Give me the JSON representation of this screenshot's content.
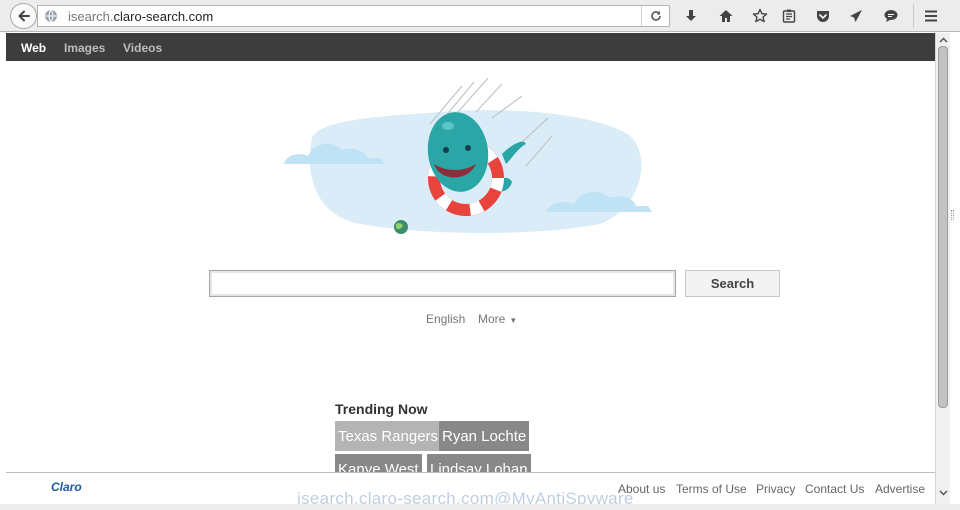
{
  "browser": {
    "url_prefix": "isearch.",
    "url_domain": "claro-search.com",
    "toolbar_icons": [
      "downloads-icon",
      "home-icon",
      "bookmark-star-icon",
      "reading-list-icon",
      "pocket-icon",
      "send-icon",
      "chat-icon",
      "menu-icon"
    ]
  },
  "nav": {
    "web": "Web",
    "images": "Images",
    "videos": "Videos"
  },
  "search": {
    "query": "",
    "button_label": "Search",
    "language": "English",
    "more": "More"
  },
  "trending": {
    "title": "Trending Now",
    "items": [
      "Texas Rangers",
      "Ryan Lochte",
      "Kanye West",
      "Lindsay Lohan"
    ]
  },
  "footer": {
    "logo": "Claro",
    "links": [
      "About us",
      "Terms of Use",
      "Privacy",
      "Contact Us",
      "Advertise"
    ]
  },
  "watermark": "isearch.claro-search.com@MyAntiSpyware",
  "colors": {
    "navbar": "#3d3d3d",
    "cloud": "#d9ecf7",
    "whale": "#2aa6a6",
    "lifebuoy": "#e8433d",
    "logo": "#1d5aa6"
  }
}
